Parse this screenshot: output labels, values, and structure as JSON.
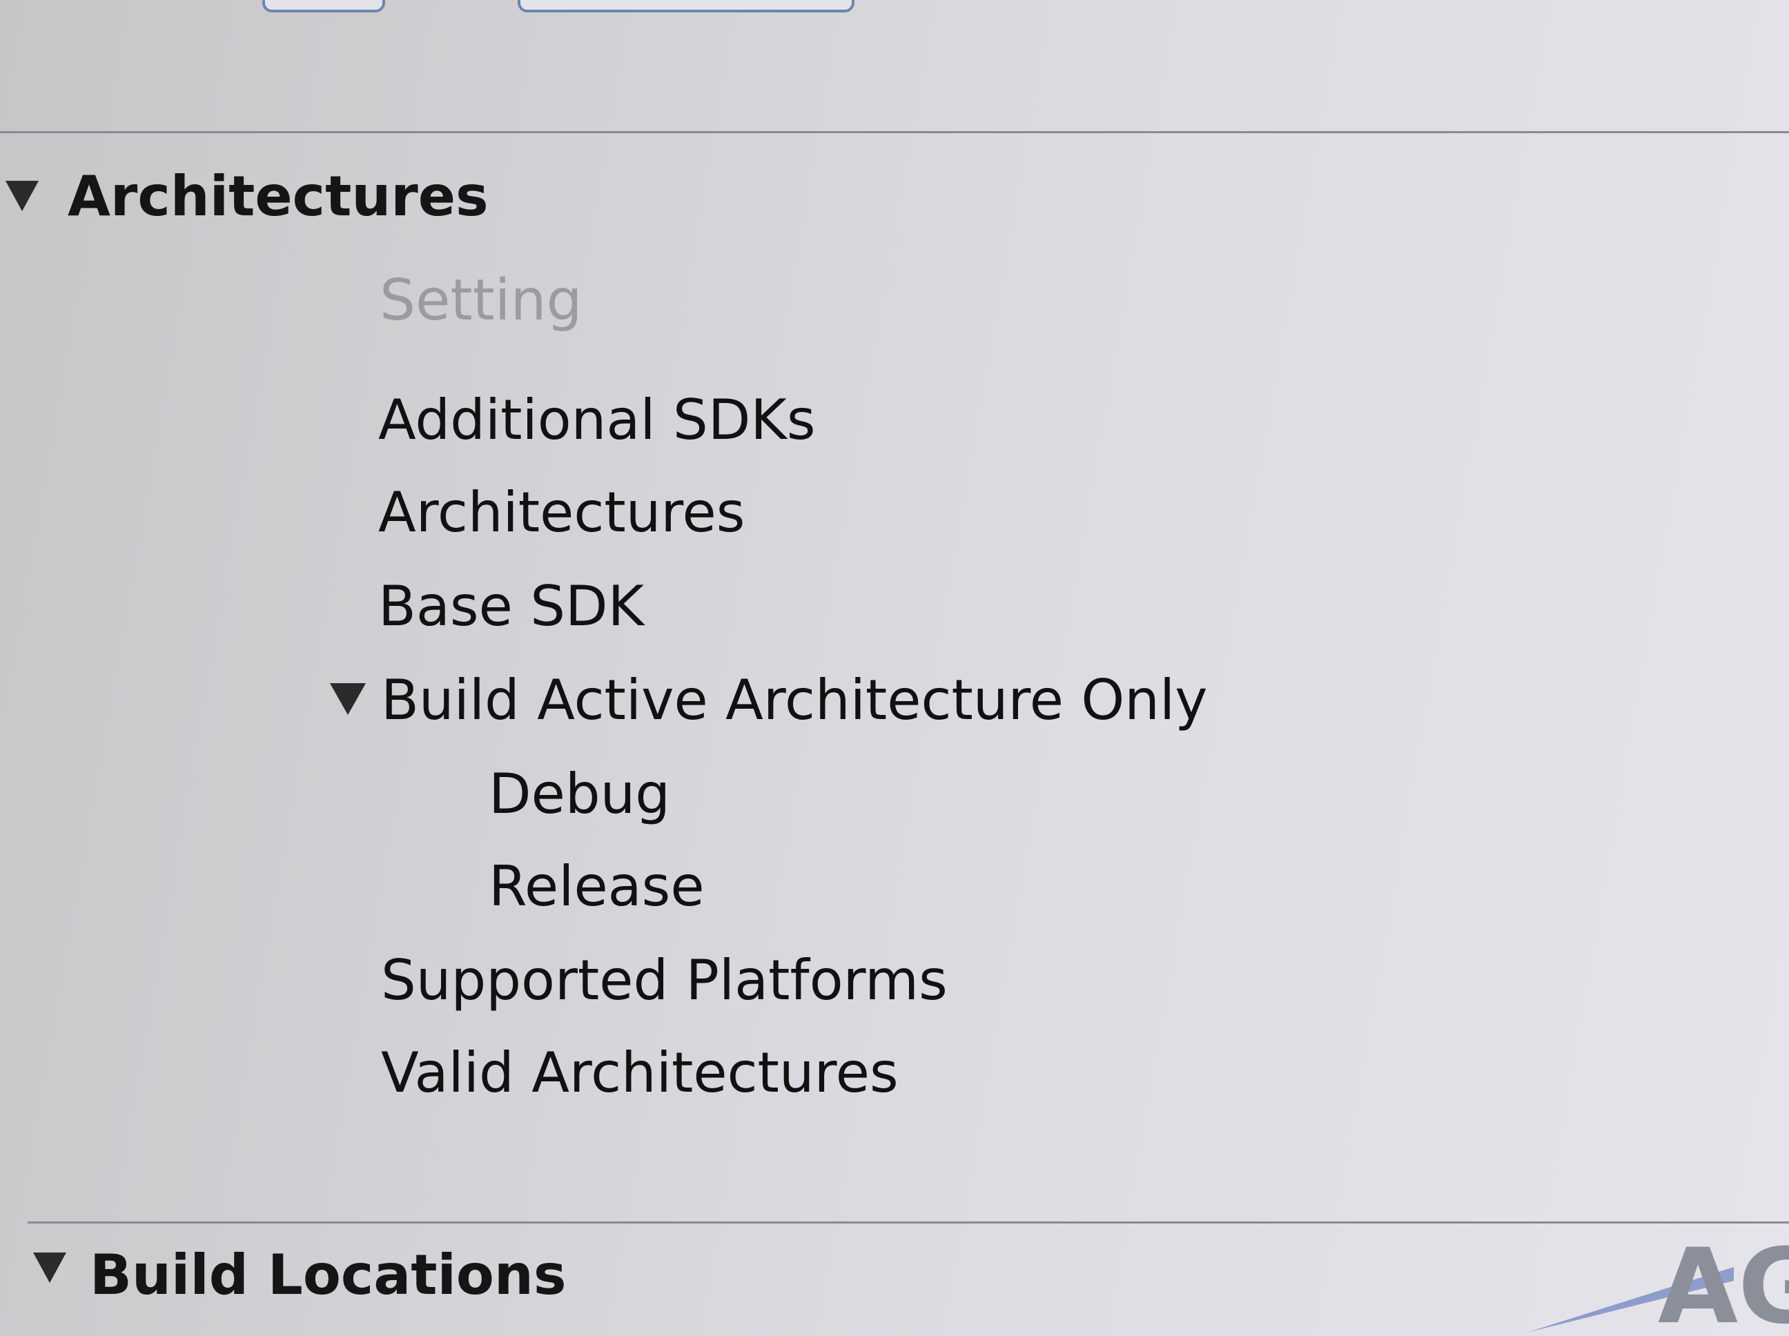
{
  "sections": {
    "architectures": {
      "title": "Architectures",
      "column_header": "Setting",
      "rows": [
        {
          "label": "Additional SDKs"
        },
        {
          "label": "Architectures"
        },
        {
          "label": "Base SDK"
        },
        {
          "label": "Build Active Architecture Only",
          "expanded": true,
          "children": [
            {
              "label": "Debug"
            },
            {
              "label": "Release"
            }
          ]
        },
        {
          "label": "Supported Platforms"
        },
        {
          "label": "Valid Architectures"
        }
      ]
    },
    "build_locations": {
      "title": "Build Locations"
    }
  },
  "watermark": {
    "text": "AG"
  },
  "icons": {
    "disclosure": "disclosure-triangle-expanded-icon"
  },
  "colors": {
    "background": "#d6d6da",
    "text": "#151515",
    "header_text": "#9b9ba3",
    "control_border": "#6e86ad"
  }
}
